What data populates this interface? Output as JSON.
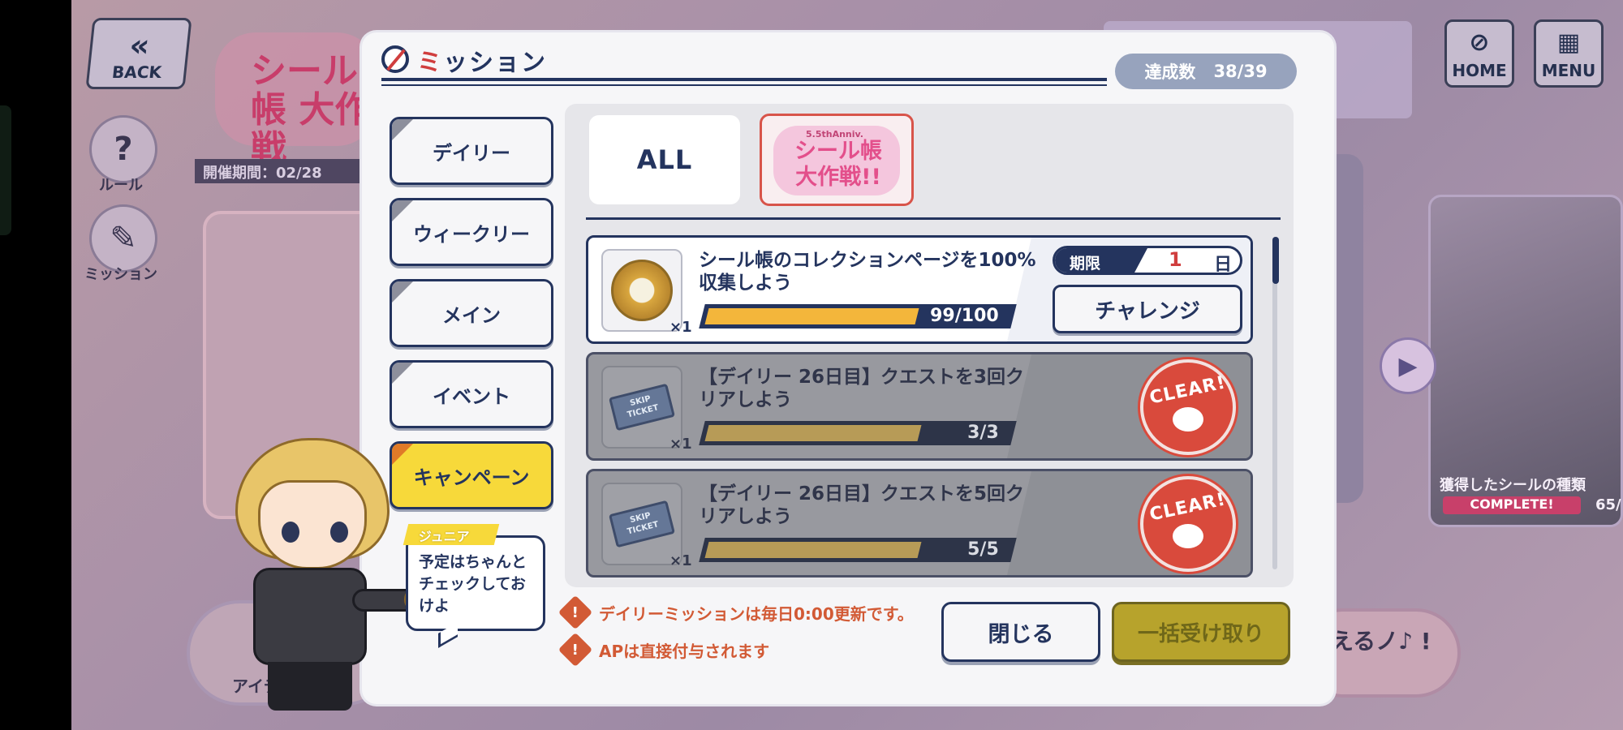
{
  "top_bar": {
    "back_label": "BACK",
    "home_label": "HOME",
    "menu_label": "MENU"
  },
  "event": {
    "logo_small": "5.5thAnniv.",
    "logo_text": "シール帳 大作戦",
    "period_label": "開催期間：02/28",
    "rule_label": "ルール",
    "mission_label": "ミッション"
  },
  "background": {
    "collected_label": "獲得したシールの種類",
    "complete_tag": "COMPLETE!",
    "collected_count": "65/",
    "right_text": "えるノ♪ !",
    "left_text": "アイテ"
  },
  "modal": {
    "title_first": "ミ",
    "title_rest": "ッション",
    "achieve_label": "達成数",
    "achieve_value": "38/39",
    "tabs": [
      {
        "label": "デイリー",
        "active": false
      },
      {
        "label": "ウィークリー",
        "active": false
      },
      {
        "label": "メイン",
        "active": false
      },
      {
        "label": "イベント",
        "active": false
      },
      {
        "label": "キャンペーン",
        "active": true
      }
    ],
    "filters": {
      "all_label": "ALL",
      "event_small": "5.5thAnniv.",
      "event_label": "シール帳 大作戦!!"
    },
    "missions": [
      {
        "text": "シール帳のコレクションページを100%収集しよう",
        "reward": "medal",
        "qty": "×1",
        "current": 99,
        "max": 100,
        "progress_text": "99/100",
        "status": "challenge",
        "limit_label": "期限",
        "limit_value": "1",
        "limit_unit": "日",
        "action_label": "チャレンジ"
      },
      {
        "text": "【デイリー 26日目】クエストを3回クリアしよう",
        "reward": "skip-ticket",
        "reward_text": "SKIP TICKET",
        "qty": "×1",
        "current": 3,
        "max": 3,
        "progress_text": "3/3",
        "status": "cleared",
        "stamp_label": "CLEAR!"
      },
      {
        "text": "【デイリー 26日目】クエストを5回クリアしよう",
        "reward": "skip-ticket",
        "reward_text": "SKIP TICKET",
        "qty": "×1",
        "current": 5,
        "max": 5,
        "progress_text": "5/5",
        "status": "cleared",
        "stamp_label": "CLEAR!"
      }
    ],
    "notes": [
      "デイリーミッションは毎日0:00更新です。",
      "APは直接付与されます"
    ],
    "close_label": "閉じる",
    "receive_all_label": "一括受け取り"
  },
  "character": {
    "name": "ジュニア",
    "speech": "予定はちゃんとチェックしておけよ"
  },
  "colors": {
    "navy": "#24345e",
    "accent_red": "#d03e3e",
    "tab_active": "#f7d93a",
    "progress_fill": "#f3b63b",
    "clear_stamp": "#d94a3c"
  }
}
